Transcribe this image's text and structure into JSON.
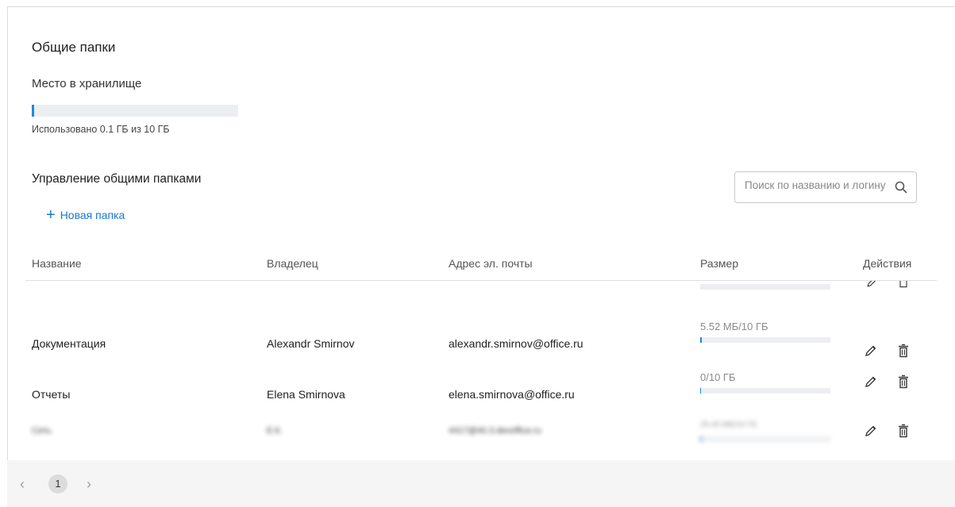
{
  "section_title": "Общие папки",
  "storage": {
    "label": "Место в хранилище",
    "used_fraction": 0.01,
    "used_text": "Использовано 0.1 ГБ из 10 ГБ",
    "accent": "#1e88e5"
  },
  "manage": {
    "title": "Управление общими папками",
    "new_folder_label": "Новая папка",
    "new_folder_icon": "plus-icon",
    "search_placeholder": "Поиск по названию и логину",
    "search_icon": "search-icon"
  },
  "table": {
    "columns": [
      "Название",
      "Владелец",
      "Адрес эл. почты",
      "Размер",
      "Действия"
    ],
    "rows": [
      {
        "name": "Документация",
        "owner": "Alexandr Smirnov",
        "email": "alexandr.smirnov@office.ru",
        "size": "5.52 МБ/10 ГБ",
        "size_fraction": 0.01
      },
      {
        "name": "Отчеты",
        "owner": "Elena Smirnova",
        "email": "elena.smirnova@office.ru",
        "size": "0/10 ГБ",
        "size_fraction": 0.005
      },
      {
        "name": "Сеть",
        "owner": "Е.К.",
        "email": "4417@40.3.devoffice.ru",
        "size": "25.45 МБ/10 ГБ",
        "size_fraction": 0.01,
        "blurred": true
      }
    ]
  },
  "pagination": {
    "current_page": "1",
    "prev_icon": "chevron-left-icon",
    "next_icon": "chevron-right-icon"
  }
}
